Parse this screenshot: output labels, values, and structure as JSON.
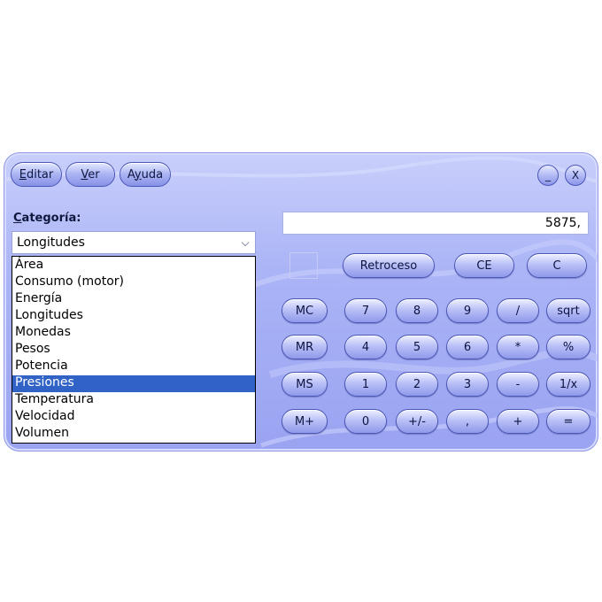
{
  "menu": {
    "items": [
      {
        "label": "Editar",
        "accel": "E"
      },
      {
        "label": "Ver",
        "accel": "V"
      },
      {
        "label": "Ayuda",
        "accel": "y"
      }
    ]
  },
  "window": {
    "minimize_label": "_",
    "close_label": "X"
  },
  "category": {
    "label": "Categoría:",
    "selected": "Longitudes",
    "options": [
      "Área",
      "Consumo (motor)",
      "Energía",
      "Longitudes",
      "Monedas",
      "Pesos",
      "Potencia",
      "Presiones",
      "Temperatura",
      "Velocidad",
      "Volumen"
    ],
    "highlighted": "Presiones"
  },
  "display": {
    "value": "5875,"
  },
  "keys": {
    "backspace": "Retroceso",
    "ce": "CE",
    "c": "C",
    "mc": "MC",
    "mr": "MR",
    "ms": "MS",
    "mplus": "M+",
    "d7": "7",
    "d8": "8",
    "d9": "9",
    "div": "/",
    "sqrt": "sqrt",
    "d4": "4",
    "d5": "5",
    "d6": "6",
    "mul": "*",
    "pct": "%",
    "d1": "1",
    "d2": "2",
    "d3": "3",
    "sub": "-",
    "inv": "1/x",
    "d0": "0",
    "sign": "+/-",
    "dec": ",",
    "add": "+",
    "eq": "="
  },
  "colors": {
    "window_bg": "#aab4f6",
    "button": "#b9c0f7",
    "selection": "#3162c6"
  }
}
